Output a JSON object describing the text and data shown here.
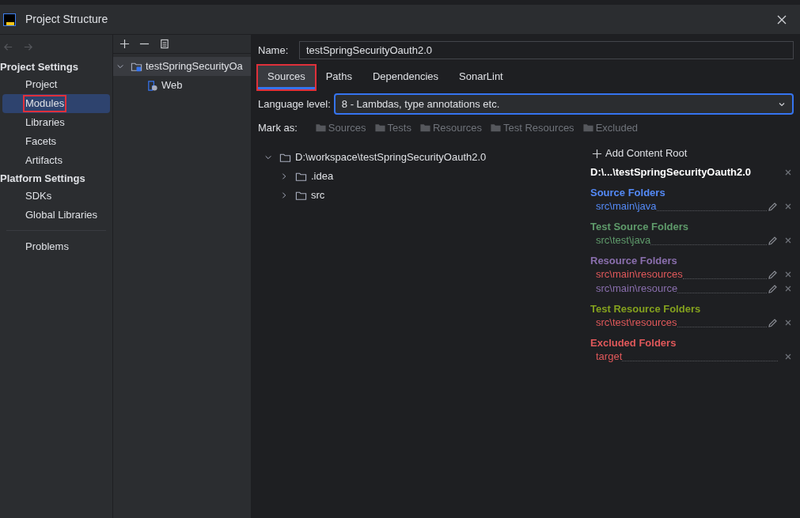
{
  "window": {
    "title": "Project Structure"
  },
  "sidebar": {
    "sections": [
      {
        "title": "Project Settings",
        "items": [
          {
            "label": "Project",
            "selected": false,
            "highlighted": false
          },
          {
            "label": "Modules",
            "selected": true,
            "highlighted": true
          },
          {
            "label": "Libraries",
            "selected": false,
            "highlighted": false
          },
          {
            "label": "Facets",
            "selected": false,
            "highlighted": false
          },
          {
            "label": "Artifacts",
            "selected": false,
            "highlighted": false
          }
        ]
      },
      {
        "title": "Platform Settings",
        "items": [
          {
            "label": "SDKs",
            "selected": false,
            "highlighted": false
          },
          {
            "label": "Global Libraries",
            "selected": false,
            "highlighted": false
          }
        ]
      }
    ],
    "bottom_items": [
      {
        "label": "Problems",
        "selected": false,
        "highlighted": false
      }
    ]
  },
  "module_tree": [
    {
      "label": "testSpringSecurityOa",
      "expanded": true,
      "selected": true,
      "children": [
        {
          "label": "Web",
          "selected": false
        }
      ]
    }
  ],
  "name_field": {
    "label": "Name:",
    "value": "testSpringSecurityOauth2.0"
  },
  "tabs": [
    {
      "label": "Sources",
      "selected": true,
      "highlighted": true
    },
    {
      "label": "Paths",
      "selected": false,
      "highlighted": false
    },
    {
      "label": "Dependencies",
      "selected": false,
      "highlighted": false
    },
    {
      "label": "SonarLint",
      "selected": false,
      "highlighted": false
    }
  ],
  "language_level": {
    "label": "Language level:",
    "value": "8 - Lambdas, type annotations etc."
  },
  "mark_as": {
    "label": "Mark as:",
    "buttons": [
      {
        "label": "Sources",
        "disabled": true
      },
      {
        "label": "Tests",
        "disabled": true
      },
      {
        "label": "Resources",
        "disabled": true
      },
      {
        "label": "Test Resources",
        "disabled": true
      },
      {
        "label": "Excluded",
        "disabled": true
      }
    ]
  },
  "content_tree": [
    {
      "label": "D:\\workspace\\testSpringSecurityOauth2.0",
      "expanded": true,
      "children": [
        {
          "label": ".idea",
          "expanded": false
        },
        {
          "label": "src",
          "expanded": false
        }
      ]
    }
  ],
  "roots_panel": {
    "add_button": "Add Content Root",
    "root": "D:\\...\\testSpringSecurityOauth2.0",
    "groups": [
      {
        "title": "Source Folders",
        "color": "#548af7",
        "entries": [
          {
            "path": "src\\main\\java",
            "color": "#548af7",
            "editable": true
          }
        ]
      },
      {
        "title": "Test Source Folders",
        "color": "#5f9b6b",
        "entries": [
          {
            "path": "src\\test\\java",
            "color": "#5f9b6b",
            "editable": true
          }
        ]
      },
      {
        "title": "Resource Folders",
        "color": "#8a6fae",
        "entries": [
          {
            "path": "src\\main\\resources",
            "color": "#e0585a",
            "editable": true
          },
          {
            "path": "src\\main\\resource",
            "color": "#8a6fae",
            "editable": true
          }
        ]
      },
      {
        "title": "Test Resource Folders",
        "color": "#84a11e",
        "entries": [
          {
            "path": "src\\test\\resources",
            "color": "#e0585a",
            "editable": true
          }
        ]
      },
      {
        "title": "Excluded Folders",
        "color": "#e0585a",
        "entries": [
          {
            "path": "target",
            "color": "#e0585a",
            "editable": false
          }
        ]
      }
    ]
  }
}
